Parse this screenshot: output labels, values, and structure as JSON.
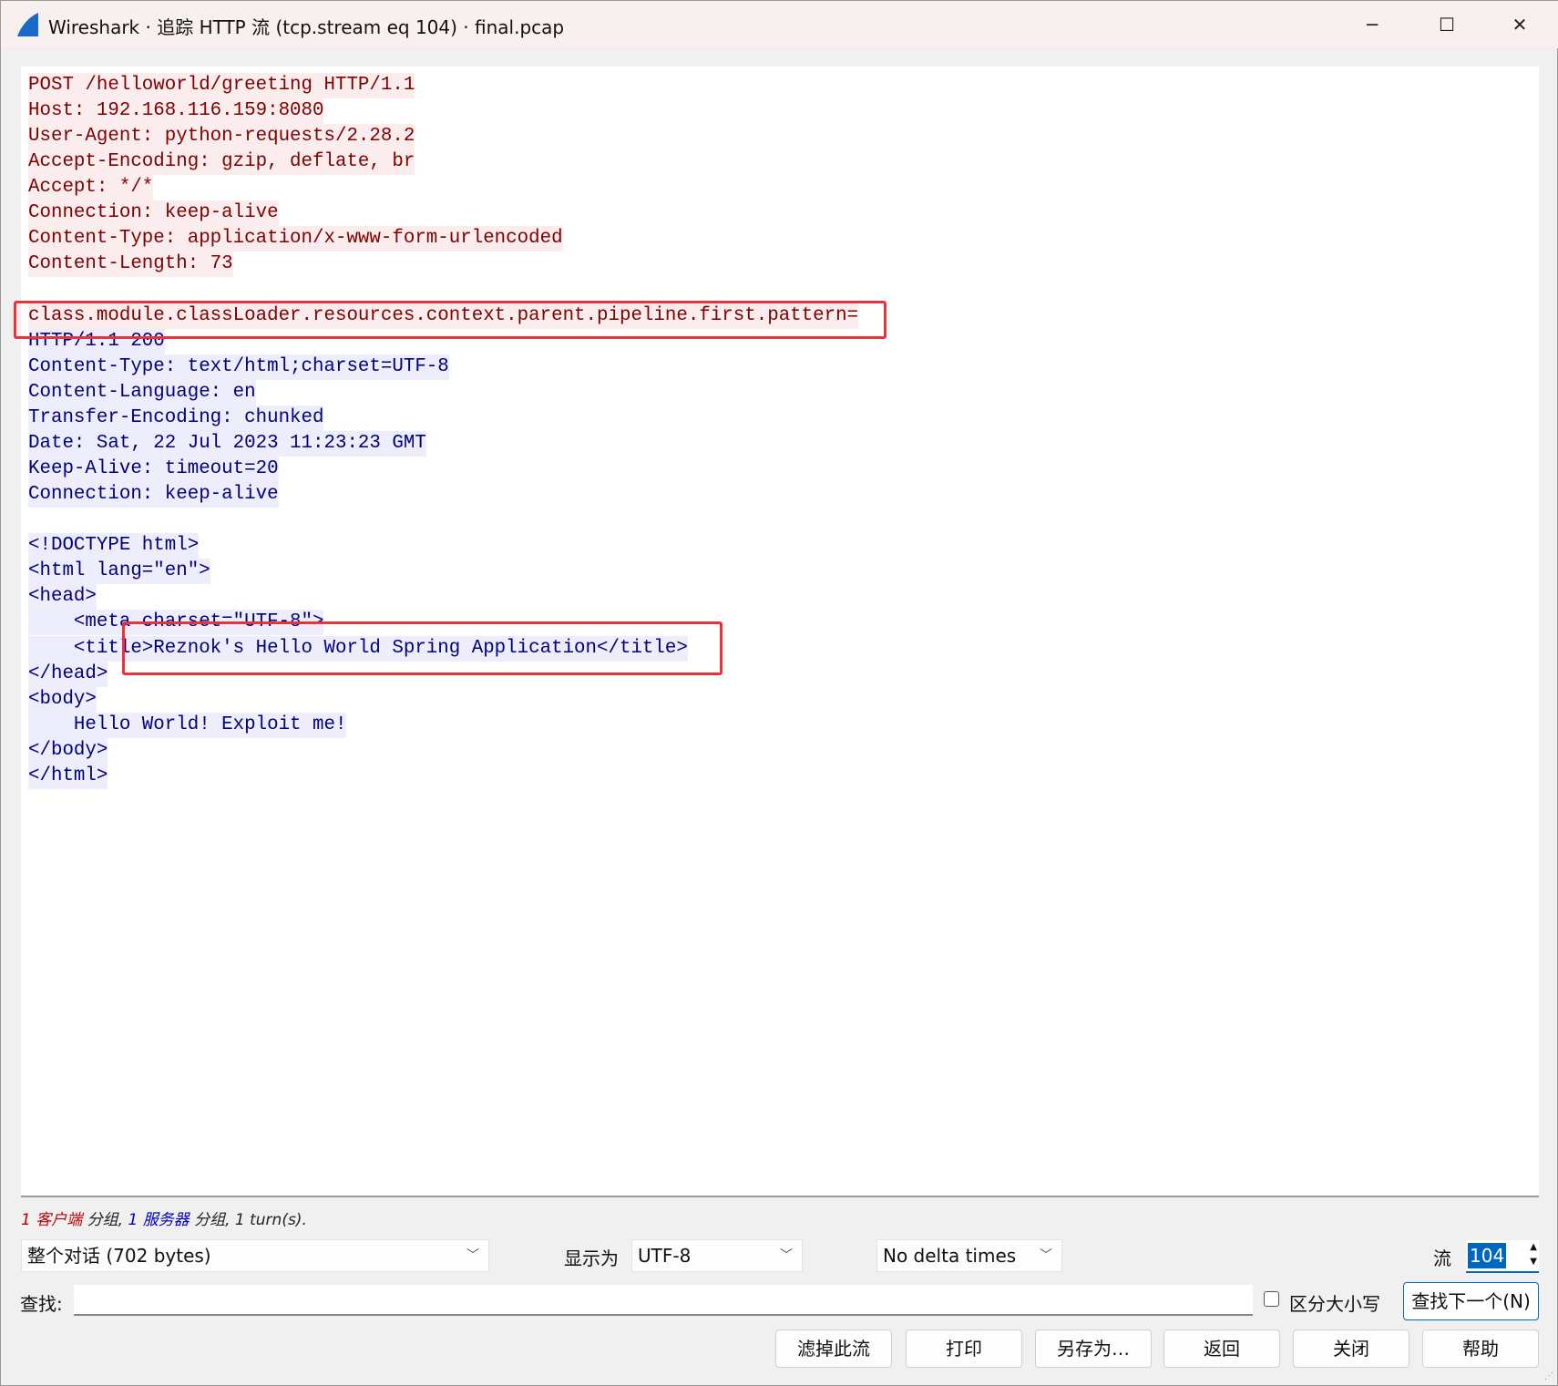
{
  "window": {
    "title": "Wireshark · 追踪 HTTP 流 (tcp.stream eq 104) · final.pcap",
    "minimize": "─",
    "maximize": "☐",
    "close": "✕"
  },
  "stream": {
    "client_lines": [
      "POST /helloworld/greeting HTTP/1.1",
      "Host: 192.168.116.159:8080",
      "User-Agent: python-requests/2.28.2",
      "Accept-Encoding: gzip, deflate, br",
      "Accept: */*",
      "Connection: keep-alive",
      "Content-Type: application/x-www-form-urlencoded",
      "Content-Length: 73",
      "",
      "class.module.classLoader.resources.context.parent.pipeline.first.pattern="
    ],
    "server_lines": [
      "HTTP/1.1 200",
      "Content-Type: text/html;charset=UTF-8",
      "Content-Language: en",
      "Transfer-Encoding: chunked",
      "Date: Sat, 22 Jul 2023 11:23:23 GMT",
      "Keep-Alive: timeout=20",
      "Connection: keep-alive",
      "",
      "<!DOCTYPE html>",
      "<html lang=\"en\">",
      "<head>",
      "    <meta charset=\"UTF-8\">",
      "    <title>Reznok's Hello World Spring Application</title>",
      "</head>",
      "<body>",
      "    Hello World! Exploit me!",
      "</body>",
      "</html>"
    ]
  },
  "status": {
    "client_count": "1",
    "client_label": "客户端",
    "sep1": " 分组, ",
    "server_count": "1",
    "server_label": "服务器",
    "sep2": " 分组, 1 turn(s)."
  },
  "controls": {
    "conversation": "整个对话 (702 bytes)",
    "show_as_label": "显示为",
    "encoding": "UTF-8",
    "delta": "No delta times",
    "stream_label": "流",
    "stream_value": "104",
    "find_label": "查找:",
    "find_value": "",
    "case_label": "区分大小写",
    "find_next": "查找下一个(N)"
  },
  "buttons": [
    "滤掉此流",
    "打印",
    "另存为…",
    "返回",
    "关闭",
    "帮助"
  ],
  "colors": {
    "client_fg": "#7f0000",
    "client_bg": "#fbeded",
    "server_fg": "#00007f",
    "server_bg": "#ededfb",
    "highlight_box": "#e8333a"
  }
}
